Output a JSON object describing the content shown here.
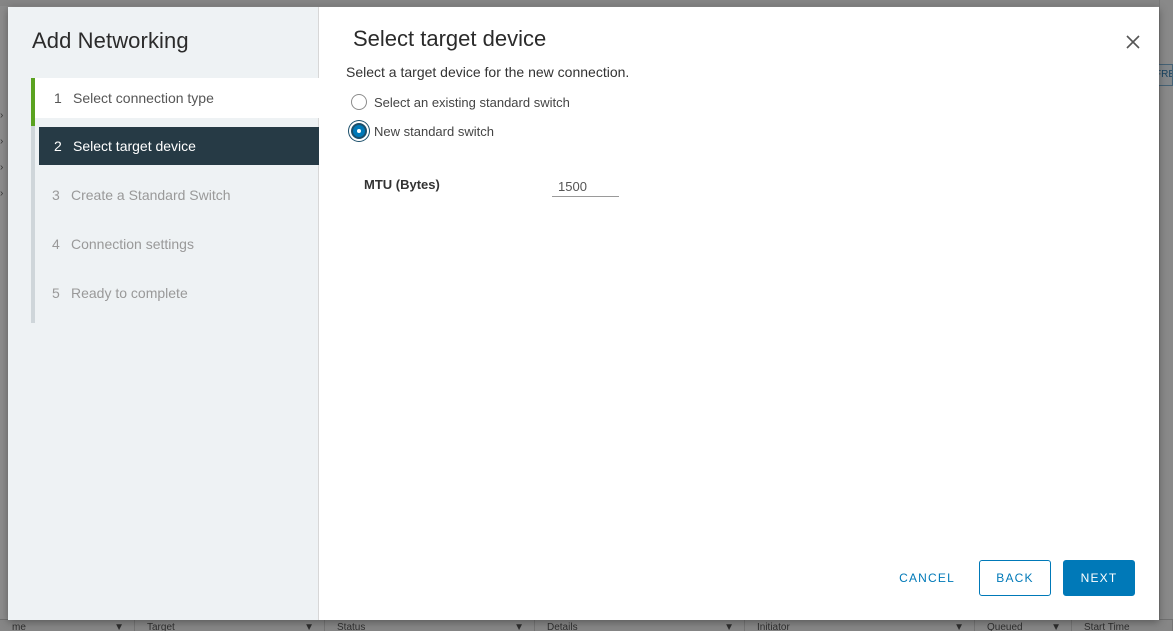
{
  "background": {
    "right_button_label": "FRE",
    "table_columns": [
      {
        "label": "me"
      },
      {
        "label": "Target"
      },
      {
        "label": "Status"
      },
      {
        "label": "Details"
      },
      {
        "label": "Initiator"
      },
      {
        "label": "Queued"
      },
      {
        "label": "Start Time"
      }
    ]
  },
  "wizard": {
    "title": "Add Networking",
    "steps": [
      {
        "num": "1",
        "label": "Select connection type",
        "state": "completed"
      },
      {
        "num": "2",
        "label": "Select target device",
        "state": "active"
      },
      {
        "num": "3",
        "label": "Create a Standard Switch",
        "state": "pending"
      },
      {
        "num": "4",
        "label": "Connection settings",
        "state": "pending"
      },
      {
        "num": "5",
        "label": "Ready to complete",
        "state": "pending"
      }
    ]
  },
  "page": {
    "title": "Select target device",
    "subtitle": "Select a target device for the new connection.",
    "options": [
      {
        "label": "Select an existing standard switch",
        "selected": false
      },
      {
        "label": "New standard switch",
        "selected": true
      }
    ],
    "mtu": {
      "label": "MTU (Bytes)",
      "value": "1500"
    }
  },
  "footer": {
    "cancel_label": "CANCEL",
    "back_label": "BACK",
    "next_label": "NEXT"
  },
  "colors": {
    "accent": "#0079b8",
    "active_step_bg": "#263a45",
    "completed_bar": "#5aa220"
  }
}
